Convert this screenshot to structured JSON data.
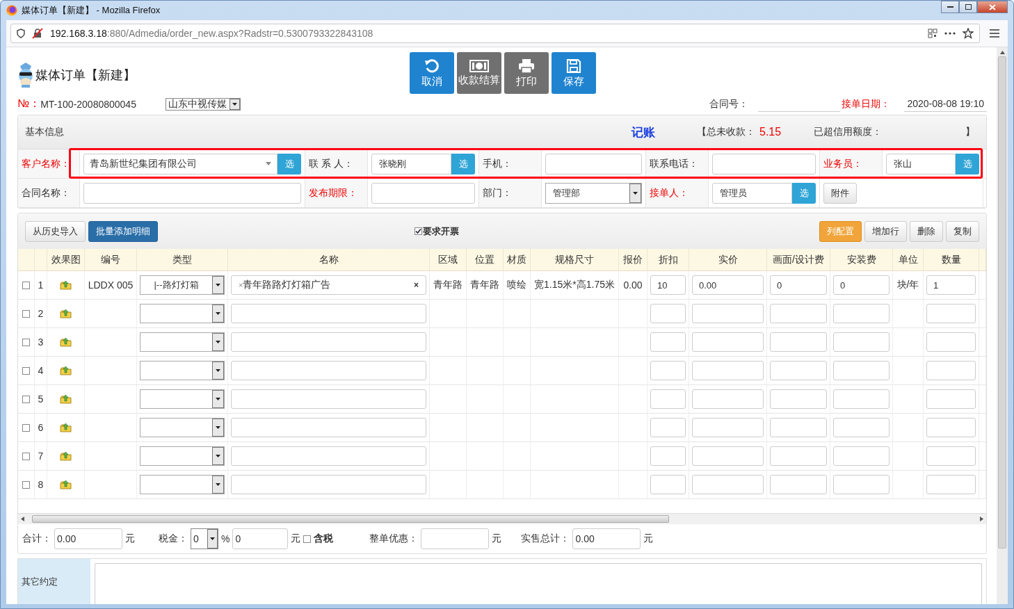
{
  "window": {
    "title": "媒体订单【新建】 - Mozilla Firefox"
  },
  "address_bar": {
    "host": "192.168.3.18",
    "path": ":880/Admedia/order_new.aspx?Radstr=0.5300793322843108"
  },
  "page": {
    "title": "媒体订单【新建】"
  },
  "toolbar": [
    {
      "label": "取消",
      "kind": "primary"
    },
    {
      "label": "收款结算",
      "kind": "secondary"
    },
    {
      "label": "打印",
      "kind": "secondary"
    },
    {
      "label": "保存",
      "kind": "primary"
    }
  ],
  "order": {
    "no_label": "№：",
    "no": "MT-100-20080800045",
    "company": "山东中视传媒",
    "contract_label": "合同号：",
    "date_label": "接单日期：",
    "date": "2020-08-08 19:10"
  },
  "basic_info": {
    "title": "基本信息",
    "bookkeeping": "记账",
    "unpaid_label": "【总未收款：",
    "unpaid": "5.15",
    "credit_label": "已超信用额度：",
    "close_bracket": "】"
  },
  "form": {
    "rows": [
      [
        {
          "label": "客户名称：",
          "required": true,
          "kind": "combo",
          "value": "青岛新世纪集团有限公司",
          "button": "选"
        },
        {
          "label": "联 系 人：",
          "required": false,
          "kind": "picker",
          "value": "张晓刚",
          "button": "选"
        },
        {
          "label": "手机：",
          "required": false,
          "kind": "text"
        },
        {
          "label": "联系电话：",
          "required": false,
          "kind": "text"
        },
        {
          "label": "业务员：",
          "required": true,
          "kind": "picker",
          "value": "张山",
          "button": "选"
        }
      ],
      [
        {
          "label": "合同名称：",
          "required": false,
          "kind": "text"
        },
        {
          "label": "发布期限：",
          "required": true,
          "kind": "text"
        },
        {
          "label": "部门：",
          "required": false,
          "kind": "select",
          "value": "管理部"
        },
        {
          "label": "接单人：",
          "required": true,
          "kind": "picker",
          "value": "管理员",
          "button": "选"
        },
        {
          "kind": "attach",
          "button": "附件"
        }
      ]
    ]
  },
  "detail_toolbar": {
    "left": [
      {
        "label": "从历史导入",
        "kind": "default"
      },
      {
        "label": "批量添加明细",
        "kind": "dark"
      }
    ],
    "invoice": {
      "label": "要求开票",
      "checked": true
    },
    "right": [
      {
        "label": "列配置",
        "kind": "warning"
      },
      {
        "label": "增加行",
        "kind": "default"
      },
      {
        "label": "删除",
        "kind": "default"
      },
      {
        "label": "复制",
        "kind": "default"
      }
    ]
  },
  "table": {
    "columns": [
      {
        "kind": "check"
      },
      {
        "kind": "index"
      },
      {
        "label": "效果图",
        "kind": "image"
      },
      {
        "label": "编号",
        "kind": "text"
      },
      {
        "label": "类型",
        "kind": "select"
      },
      {
        "label": "名称",
        "kind": "tag"
      },
      {
        "label": "区域",
        "kind": "text"
      },
      {
        "label": "位置",
        "kind": "text"
      },
      {
        "label": "材质",
        "kind": "text"
      },
      {
        "label": "规格尺寸",
        "kind": "text"
      },
      {
        "label": "报价",
        "kind": "text"
      },
      {
        "label": "折扣",
        "kind": "input"
      },
      {
        "label": "实价",
        "kind": "input"
      },
      {
        "label": "画面/设计费",
        "kind": "input"
      },
      {
        "label": "安装费",
        "kind": "input"
      },
      {
        "label": "单位",
        "kind": "text"
      },
      {
        "label": "数量",
        "kind": "input"
      }
    ],
    "rows": [
      {
        "no": "1",
        "checked": false,
        "tag_remove": "×",
        "clear": "×",
        "values": [
          "LDDX 005",
          "|--路灯灯箱",
          "青年路路灯灯箱广告",
          "青年路",
          "青年路",
          "喷绘",
          "宽1.15米*高1.75米",
          "0.00",
          "10",
          "0.00",
          "0",
          "0",
          "块/年",
          "1"
        ]
      },
      {
        "no": "2",
        "checked": false
      },
      {
        "no": "3",
        "checked": false
      },
      {
        "no": "4",
        "checked": false
      },
      {
        "no": "5",
        "checked": false
      },
      {
        "no": "6",
        "checked": false
      },
      {
        "no": "7",
        "checked": false
      },
      {
        "no": "8",
        "checked": false
      }
    ]
  },
  "totals": {
    "sum_label": "合计：",
    "sum": "0.00",
    "unit": "元",
    "tax_label": "税金：",
    "tax_rate": "0",
    "percent": "%",
    "tax": "0",
    "tax_unit": "元",
    "tax_included": {
      "label": "含税",
      "checked": false
    },
    "discount_label": "整单优惠：",
    "discount_unit": "元",
    "total_label": "实售总计：",
    "total": "0.00",
    "total_unit": "元"
  },
  "other": {
    "label": "其它约定"
  }
}
